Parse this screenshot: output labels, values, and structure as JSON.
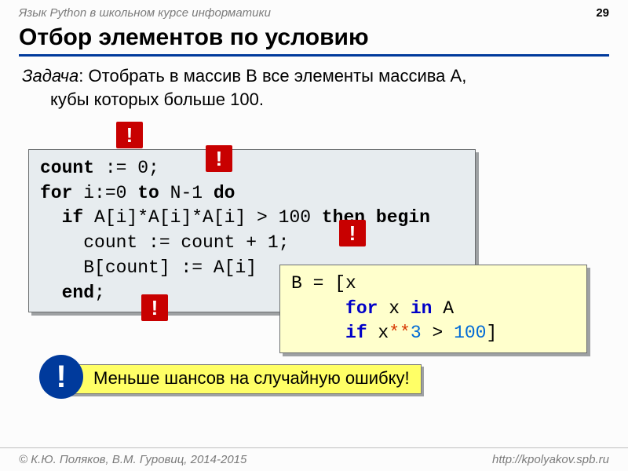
{
  "header": {
    "course": "Язык Python в школьном курсе информатики",
    "page": "29"
  },
  "title": "Отбор элементов по условию",
  "task": {
    "label": "Задача",
    "text1": ": Отобрать в массив B все элементы массива A,",
    "text2": "кубы которых больше 100."
  },
  "code_main": {
    "l1a": "count",
    "l1b": " := 0;",
    "l2a": "for",
    "l2b": " i:=0 ",
    "l2c": "to",
    "l2d": " N-1 ",
    "l2e": "do",
    "l3a": "  if",
    "l3b": " A[i]*A[i]*A[i] > 100 ",
    "l3c": "then begin",
    "l4": "    count := count + 1;",
    "l5": "    B[count] := A[i]",
    "l6a": "  end",
    "l6b": ";"
  },
  "code_py": {
    "l1": "B = [x",
    "l2a": "     ",
    "l2b": "for",
    "l2c": " x ",
    "l2d": "in",
    "l2e": " A",
    "l3a": "     ",
    "l3b": "if",
    "l3c": " x",
    "l3d": "**",
    "l3e": "3",
    "l3f": " > ",
    "l3g": "100",
    "l3h": "]"
  },
  "bang": "!",
  "note": "Меньше шансов на случайную ошибку!",
  "footer": {
    "left": "© К.Ю. Поляков, В.М. Гуровиц, 2014-2015",
    "right": "http://kpolyakov.spb.ru"
  }
}
